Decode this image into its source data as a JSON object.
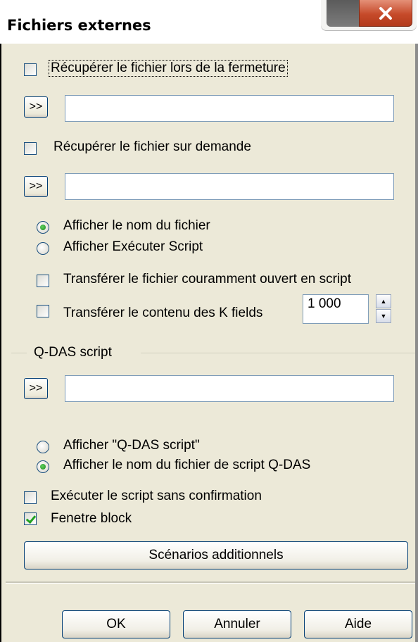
{
  "window": {
    "title": "Fichiers externes",
    "close_glyph": "X"
  },
  "options": {
    "retrieve_on_close_label": "Récupérer le fichier lors de la fermeture",
    "retrieve_on_close_checked": false,
    "path1_value": "",
    "retrieve_on_demand_label": "Récupérer le fichier sur demande",
    "retrieve_on_demand_checked": false,
    "path2_value": "",
    "show_filename_label": "Afficher le nom du fichier",
    "show_exec_script_label": "Afficher Exécuter Script",
    "display_selected": "show_filename",
    "transfer_open_label": "Transférer le fichier couramment ouvert en script",
    "transfer_kfields_label": "Transférer le contenu des K fields",
    "kfields_value": "1 000"
  },
  "qdas": {
    "group_label": "Q-DAS script",
    "path_value": "",
    "show_qdas_label": "Afficher \"Q-DAS script\"",
    "show_script_name_label": "Afficher le nom du fichier de script Q-DAS",
    "display_selected": "show_script_name",
    "exec_no_confirm_label": "Exécuter le script sans confirmation",
    "exec_no_confirm_checked": false,
    "fenetre_block_label": "Fenetre block",
    "fenetre_block_checked": true
  },
  "browse_label": ">>",
  "buttons": {
    "scenarios": "Scénarios additionnels",
    "ok": "OK",
    "cancel": "Annuler",
    "help": "Aide"
  },
  "icons": {
    "close": "close-icon",
    "spin_up": "arrow-up-icon",
    "spin_down": "arrow-down-icon"
  },
  "colors": {
    "dialog_bg": "#ece9d8",
    "close_button": "#c64a2a",
    "check_mark": "#21a121",
    "radio_dot": "#1f8a1f",
    "border_blue": "#003c74"
  }
}
